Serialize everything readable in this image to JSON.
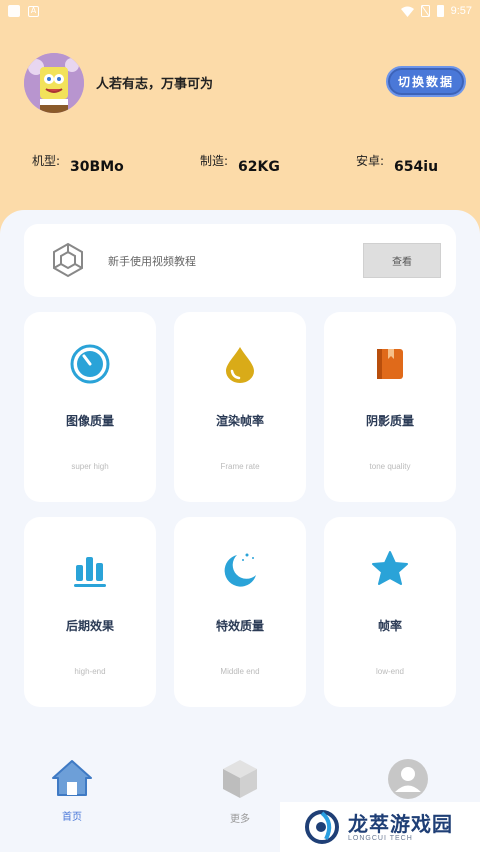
{
  "status_bar": {
    "time": "9:57",
    "left_badge": "A"
  },
  "profile": {
    "motto": "人若有志，万事可为",
    "switch_label": "切换数据"
  },
  "specs": [
    {
      "key": "机型:",
      "value": "30BMo"
    },
    {
      "key": "制造:",
      "value": "62KG"
    },
    {
      "key": "安卓:",
      "value": "654iu"
    }
  ],
  "tutorial": {
    "text": "新手使用视频教程",
    "button": "查看"
  },
  "cards": [
    {
      "title": "图像质量",
      "subtitle": "super high",
      "icon": "timer-icon"
    },
    {
      "title": "渲染帧率",
      "subtitle": "Frame rate",
      "icon": "drop-icon"
    },
    {
      "title": "阴影质量",
      "subtitle": "tone quality",
      "icon": "book-icon"
    },
    {
      "title": "后期效果",
      "subtitle": "high-end",
      "icon": "bars-icon"
    },
    {
      "title": "特效质量",
      "subtitle": "Middle end",
      "icon": "moon-icon"
    },
    {
      "title": "帧率",
      "subtitle": "low-end",
      "icon": "star-icon"
    }
  ],
  "nav": [
    {
      "label": "首页",
      "icon": "home-icon",
      "active": true
    },
    {
      "label": "更多",
      "icon": "cube-icon",
      "active": false
    }
  ],
  "watermark": {
    "cn": "龙萃游戏园",
    "en": "LONGCUI TECH"
  },
  "colors": {
    "accent": "#4a78d8",
    "header_bg": "#fcdba9",
    "panel_bg": "#f3f6fc",
    "icon_blue": "#2aa3d8"
  }
}
